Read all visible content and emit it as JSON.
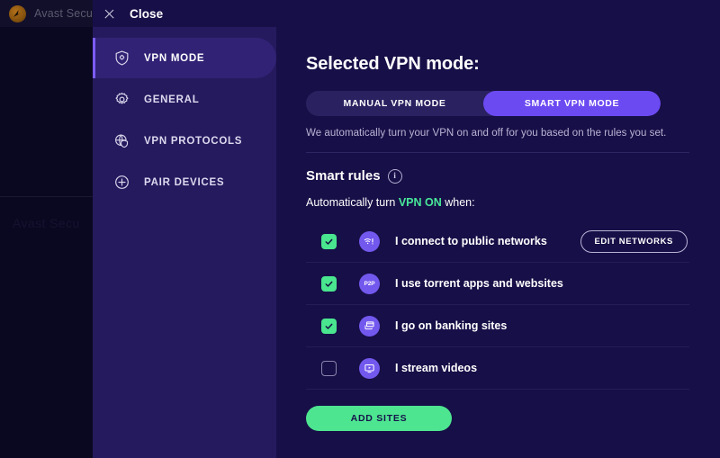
{
  "background_app": {
    "title": "Avast Secu",
    "logo_icon": "avast-logo-icon"
  },
  "overlay": {
    "close": {
      "label": "Close",
      "icon": "close-icon"
    },
    "sidebar": {
      "items": [
        {
          "label": "VPN MODE",
          "icon": "shield-gear-icon",
          "active": true
        },
        {
          "label": "GENERAL",
          "icon": "gear-icon",
          "active": false
        },
        {
          "label": "VPN PROTOCOLS",
          "icon": "globe-shield-icon",
          "active": false
        },
        {
          "label": "PAIR DEVICES",
          "icon": "plus-circle-icon",
          "active": false
        }
      ]
    },
    "content": {
      "page_title": "Selected VPN mode:",
      "mode_toggle": {
        "options": [
          {
            "label": "MANUAL VPN MODE",
            "selected": false
          },
          {
            "label": "SMART VPN MODE",
            "selected": true
          }
        ]
      },
      "mode_description": "We automatically turn your VPN on and off for you based on the rules you set.",
      "smart_rules": {
        "title": "Smart rules",
        "info_icon": "info-icon",
        "info_glyph": "i",
        "auto_prefix": "Automatically turn ",
        "auto_accent": "VPN ON",
        "auto_suffix": " when:",
        "rules": [
          {
            "label": "I connect to public networks",
            "checked": true,
            "icon": "wifi-alert-icon",
            "action_label": "EDIT NETWORKS"
          },
          {
            "label": "I use torrent apps and websites",
            "checked": true,
            "icon": "p2p-icon",
            "icon_text": "P2P",
            "action_label": ""
          },
          {
            "label": "I go on banking sites",
            "checked": true,
            "icon": "bank-cards-icon",
            "action_label": ""
          },
          {
            "label": "I stream videos",
            "checked": false,
            "icon": "video-monitor-icon",
            "action_label": ""
          }
        ],
        "add_sites_label": "ADD SITES"
      }
    }
  },
  "colors": {
    "accent_purple": "#6c4af2",
    "accent_green": "#4ee591",
    "panel_bg": "#170f47",
    "sidebar_bg": "#251a5e",
    "active_nav": "#312275",
    "rule_icon_bg": "#7358ee"
  }
}
